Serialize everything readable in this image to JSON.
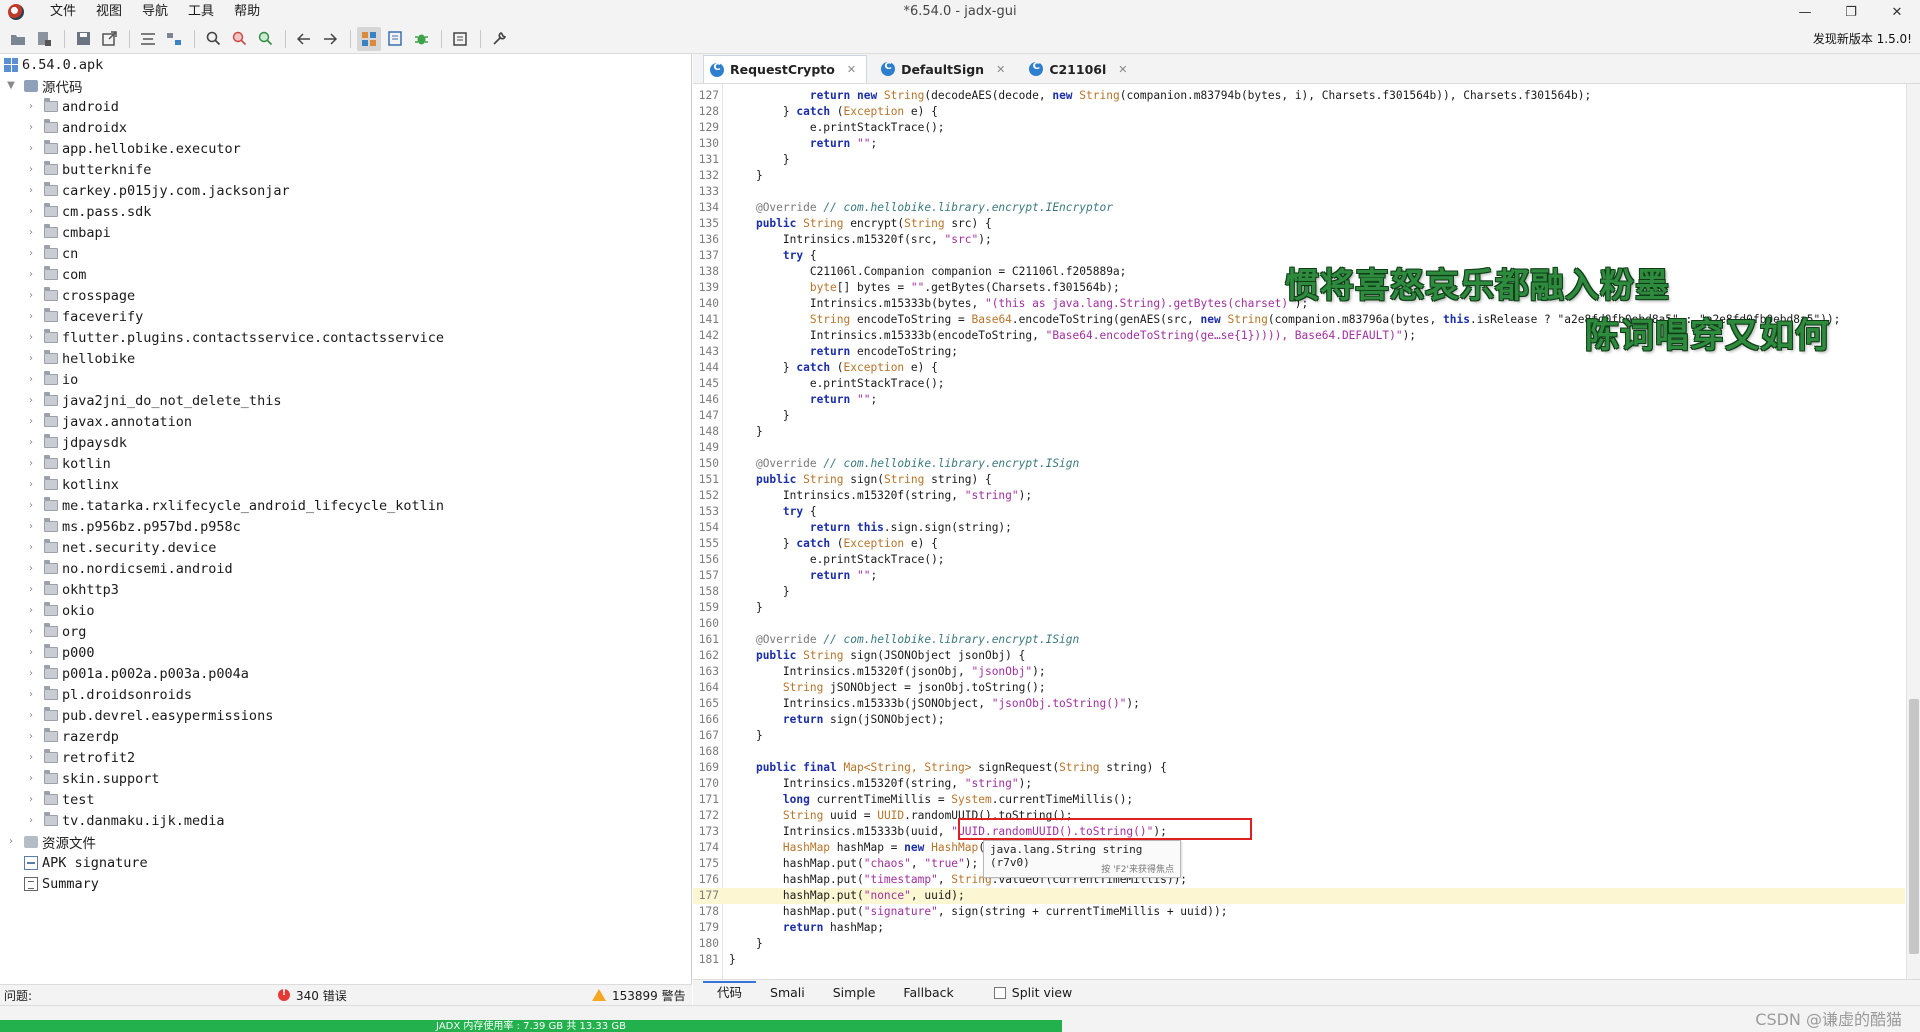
{
  "window": {
    "title": "*6.54.0 - jadx-gui",
    "menu": [
      "文件",
      "视图",
      "导航",
      "工具",
      "帮助"
    ],
    "controls": [
      "—",
      "❐",
      "✕"
    ]
  },
  "toolbar": {
    "update_note": "发现新版本 1.5.0!",
    "icons": [
      "open-file-icon",
      "add-files-icon",
      "save-icon",
      "export-icon",
      "sync-icon",
      "flatten-icon",
      "search-icon",
      "search-text-icon",
      "find-usage-icon",
      "back-icon",
      "forward-icon",
      "decompile-all-icon",
      "bookmark-icon",
      "debug-icon",
      "log-icon",
      "preferences-icon"
    ]
  },
  "tree": {
    "root": "6.54.0.apk",
    "source_node": "源代码",
    "packages": [
      "android",
      "androidx",
      "app.hellobike.executor",
      "butterknife",
      "carkey.p015jy.com.jacksonjar",
      "cm.pass.sdk",
      "cmbapi",
      "cn",
      "com",
      "crosspage",
      "faceverify",
      "flutter.plugins.contactsservice.contactsservice",
      "hellobike",
      "io",
      "java2jni_do_not_delete_this",
      "javax.annotation",
      "jdpaysdk",
      "kotlin",
      "kotlinx",
      "me.tatarka.rxlifecycle_android_lifecycle_kotlin",
      "ms.p956bz.p957bd.p958c",
      "net.security.device",
      "no.nordicsemi.android",
      "okhttp3",
      "okio",
      "org",
      "p000",
      "p001a.p002a.p003a.p004a",
      "pl.droidsonroids",
      "pub.devrel.easypermissions",
      "razerdp",
      "retrofit2",
      "skin.support",
      "test",
      "tv.danmaku.ijk.media"
    ],
    "resources_node": "资源文件",
    "signature_node": "APK signature",
    "summary_node": "Summary"
  },
  "tabs": [
    {
      "label": "RequestCrypto",
      "close": "✕"
    },
    {
      "label": "DefaultSign",
      "close": "✕"
    },
    {
      "label": "C21106l",
      "close": "✕"
    }
  ],
  "code": {
    "highlight_line": 177,
    "lines": [
      {
        "n": "127",
        "t": [
          [
            "",
            "            "
          ],
          [
            "kw",
            "return new "
          ],
          [
            "ty",
            "String"
          ],
          [
            "pl",
            "(decodeAES(decode, "
          ],
          [
            "kw",
            "new "
          ],
          [
            "ty",
            "String"
          ],
          [
            "pl",
            "(companion.m83794b(bytes, i), Charsets.f301564b)), Charsets.f301564b);"
          ]
        ]
      },
      {
        "n": "128",
        "t": [
          [
            "",
            "        "
          ],
          [
            "pl",
            "} "
          ],
          [
            "kw",
            "catch "
          ],
          [
            "pl",
            "("
          ],
          [
            "ty",
            "Exception"
          ],
          [
            "pl",
            " e) {"
          ]
        ]
      },
      {
        "n": "129",
        "t": [
          [
            "",
            "            "
          ],
          [
            "pl",
            "e.printStackTrace();"
          ]
        ]
      },
      {
        "n": "130",
        "t": [
          [
            "",
            "            "
          ],
          [
            "kw",
            "return "
          ],
          [
            "st",
            "\"\""
          ],
          [
            "pl",
            ";"
          ]
        ]
      },
      {
        "n": "131",
        "t": [
          [
            "",
            "        "
          ],
          [
            "pl",
            "}"
          ]
        ]
      },
      {
        "n": "132",
        "t": [
          [
            "",
            "    "
          ],
          [
            "pl",
            "}"
          ]
        ]
      },
      {
        "n": "133",
        "t": [
          [
            "",
            ""
          ]
        ]
      },
      {
        "n": "134",
        "t": [
          [
            "",
            "    "
          ],
          [
            "an",
            "@Override "
          ],
          [
            "cm",
            "// com.hellobike.library.encrypt.IEncryptor"
          ]
        ]
      },
      {
        "n": "135",
        "t": [
          [
            "",
            "    "
          ],
          [
            "kw",
            "public "
          ],
          [
            "ty",
            "String "
          ],
          [
            "pl",
            "encrypt("
          ],
          [
            "ty",
            "String "
          ],
          [
            "pl",
            "src) {"
          ]
        ]
      },
      {
        "n": "136",
        "t": [
          [
            "",
            "        "
          ],
          [
            "pl",
            "Intrinsics.m15320f(src, "
          ],
          [
            "st",
            "\"src\""
          ],
          [
            "pl",
            ");"
          ]
        ]
      },
      {
        "n": "137",
        "t": [
          [
            "",
            "        "
          ],
          [
            "kw",
            "try "
          ],
          [
            "pl",
            "{"
          ]
        ]
      },
      {
        "n": "138",
        "t": [
          [
            "",
            "            "
          ],
          [
            "pl",
            "C21106l.Companion companion = C21106l.f205889a;"
          ]
        ]
      },
      {
        "n": "139",
        "t": [
          [
            "",
            "            "
          ],
          [
            "ty",
            "byte"
          ],
          [
            "pl",
            "[] bytes = "
          ],
          [
            "st",
            "\"\""
          ],
          [
            "pl",
            ".getBytes(Charsets.f301564b);"
          ]
        ]
      },
      {
        "n": "140",
        "t": [
          [
            "",
            "            "
          ],
          [
            "pl",
            "Intrinsics.m15333b(bytes, "
          ],
          [
            "st",
            "\"(this as java.lang.String).getBytes(charset)\""
          ],
          [
            "pl",
            ");"
          ]
        ]
      },
      {
        "n": "141",
        "t": [
          [
            "",
            "            "
          ],
          [
            "ty",
            "String "
          ],
          [
            "pl",
            "encodeToString = "
          ],
          [
            "ty",
            "Base64"
          ],
          [
            "pl",
            ".encodeToString(genAES(src, "
          ],
          [
            "kw",
            "new "
          ],
          [
            "ty",
            "String"
          ],
          [
            "pl",
            "(companion.m83796a(bytes, "
          ],
          [
            "kw",
            "this"
          ],
          [
            "pl",
            ".isRelease ? \"a2e8fd0fb0ebd8a5\" : \"a2e8fd0fb0ebd8a5\"));"
          ]
        ]
      },
      {
        "n": "142",
        "t": [
          [
            "",
            "            "
          ],
          [
            "pl",
            "Intrinsics.m15333b(encodeToString, "
          ],
          [
            "st",
            "\"Base64.encodeToString(ge…se{1})))), Base64.DEFAULT)\""
          ],
          [
            "pl",
            ");"
          ]
        ]
      },
      {
        "n": "143",
        "t": [
          [
            "",
            "            "
          ],
          [
            "kw",
            "return "
          ],
          [
            "pl",
            "encodeToString;"
          ]
        ]
      },
      {
        "n": "144",
        "t": [
          [
            "",
            "        "
          ],
          [
            "pl",
            "} "
          ],
          [
            "kw",
            "catch "
          ],
          [
            "pl",
            "("
          ],
          [
            "ty",
            "Exception"
          ],
          [
            "pl",
            " e) {"
          ]
        ]
      },
      {
        "n": "145",
        "t": [
          [
            "",
            "            "
          ],
          [
            "pl",
            "e.printStackTrace();"
          ]
        ]
      },
      {
        "n": "146",
        "t": [
          [
            "",
            "            "
          ],
          [
            "kw",
            "return "
          ],
          [
            "st",
            "\"\""
          ],
          [
            "pl",
            ";"
          ]
        ]
      },
      {
        "n": "147",
        "t": [
          [
            "",
            "        "
          ],
          [
            "pl",
            "}"
          ]
        ]
      },
      {
        "n": "148",
        "t": [
          [
            "",
            "    "
          ],
          [
            "pl",
            "}"
          ]
        ]
      },
      {
        "n": "149",
        "t": [
          [
            "",
            ""
          ]
        ]
      },
      {
        "n": "150",
        "t": [
          [
            "",
            "    "
          ],
          [
            "an",
            "@Override "
          ],
          [
            "cm",
            "// com.hellobike.library.encrypt.ISign"
          ]
        ]
      },
      {
        "n": "151",
        "t": [
          [
            "",
            "    "
          ],
          [
            "kw",
            "public "
          ],
          [
            "ty",
            "String "
          ],
          [
            "pl",
            "sign("
          ],
          [
            "ty",
            "String "
          ],
          [
            "pl",
            "string) {"
          ]
        ]
      },
      {
        "n": "152",
        "t": [
          [
            "",
            "        "
          ],
          [
            "pl",
            "Intrinsics.m15320f(string, "
          ],
          [
            "st",
            "\"string\""
          ],
          [
            "pl",
            ");"
          ]
        ]
      },
      {
        "n": "153",
        "t": [
          [
            "",
            "        "
          ],
          [
            "kw",
            "try "
          ],
          [
            "pl",
            "{"
          ]
        ]
      },
      {
        "n": "154",
        "t": [
          [
            "",
            "            "
          ],
          [
            "kw",
            "return this"
          ],
          [
            "pl",
            ".sign.sign(string);"
          ]
        ]
      },
      {
        "n": "155",
        "t": [
          [
            "",
            "        "
          ],
          [
            "pl",
            "} "
          ],
          [
            "kw",
            "catch "
          ],
          [
            "pl",
            "("
          ],
          [
            "ty",
            "Exception"
          ],
          [
            "pl",
            " e) {"
          ]
        ]
      },
      {
        "n": "156",
        "t": [
          [
            "",
            "            "
          ],
          [
            "pl",
            "e.printStackTrace();"
          ]
        ]
      },
      {
        "n": "157",
        "t": [
          [
            "",
            "            "
          ],
          [
            "kw",
            "return "
          ],
          [
            "st",
            "\"\""
          ],
          [
            "pl",
            ";"
          ]
        ]
      },
      {
        "n": "158",
        "t": [
          [
            "",
            "        "
          ],
          [
            "pl",
            "}"
          ]
        ]
      },
      {
        "n": "159",
        "t": [
          [
            "",
            "    "
          ],
          [
            "pl",
            "}"
          ]
        ]
      },
      {
        "n": "160",
        "t": [
          [
            "",
            ""
          ]
        ]
      },
      {
        "n": "161",
        "t": [
          [
            "",
            "    "
          ],
          [
            "an",
            "@Override "
          ],
          [
            "cm",
            "// com.hellobike.library.encrypt.ISign"
          ]
        ]
      },
      {
        "n": "162",
        "t": [
          [
            "",
            "    "
          ],
          [
            "kw",
            "public "
          ],
          [
            "ty",
            "String "
          ],
          [
            "pl",
            "sign(JSONObject jsonObj) {"
          ]
        ]
      },
      {
        "n": "163",
        "t": [
          [
            "",
            "        "
          ],
          [
            "pl",
            "Intrinsics.m15320f(jsonObj, "
          ],
          [
            "st",
            "\"jsonObj\""
          ],
          [
            "pl",
            ");"
          ]
        ]
      },
      {
        "n": "164",
        "t": [
          [
            "",
            "        "
          ],
          [
            "ty",
            "String "
          ],
          [
            "pl",
            "jSONObject = jsonObj.toString();"
          ]
        ]
      },
      {
        "n": "165",
        "t": [
          [
            "",
            "        "
          ],
          [
            "pl",
            "Intrinsics.m15333b(jSONObject, "
          ],
          [
            "st",
            "\"jsonObj.toString()\""
          ],
          [
            "pl",
            ");"
          ]
        ]
      },
      {
        "n": "166",
        "t": [
          [
            "",
            "        "
          ],
          [
            "kw",
            "return "
          ],
          [
            "pl",
            "sign(jSONObject);"
          ]
        ]
      },
      {
        "n": "167",
        "t": [
          [
            "",
            "    "
          ],
          [
            "pl",
            "}"
          ]
        ]
      },
      {
        "n": "168",
        "t": [
          [
            "",
            ""
          ]
        ]
      },
      {
        "n": "169",
        "t": [
          [
            "",
            "    "
          ],
          [
            "kw",
            "public final "
          ],
          [
            "ty",
            "Map<String, String> "
          ],
          [
            "pl",
            "signRequest("
          ],
          [
            "ty",
            "String "
          ],
          [
            "pl",
            "string) {"
          ]
        ]
      },
      {
        "n": "170",
        "t": [
          [
            "",
            "        "
          ],
          [
            "pl",
            "Intrinsics.m15320f(string, "
          ],
          [
            "st",
            "\"string\""
          ],
          [
            "pl",
            ");"
          ]
        ]
      },
      {
        "n": "171",
        "t": [
          [
            "",
            "        "
          ],
          [
            "kw",
            "long "
          ],
          [
            "pl",
            "currentTimeMillis = "
          ],
          [
            "ty",
            "System"
          ],
          [
            "pl",
            ".currentTimeMillis();"
          ]
        ]
      },
      {
        "n": "172",
        "t": [
          [
            "",
            "        "
          ],
          [
            "ty",
            "String "
          ],
          [
            "pl",
            "uuid = "
          ],
          [
            "ty",
            "UUID"
          ],
          [
            "pl",
            ".randomUUID().toString();"
          ]
        ]
      },
      {
        "n": "173",
        "t": [
          [
            "",
            "        "
          ],
          [
            "pl",
            "Intrinsics.m15333b(uuid, "
          ],
          [
            "st",
            "\"UUID.randomUUID().toString()\""
          ],
          [
            "pl",
            ");"
          ]
        ]
      },
      {
        "n": "174",
        "t": [
          [
            "",
            "        "
          ],
          [
            "ty",
            "HashMap "
          ],
          [
            "pl",
            "hashMap = "
          ],
          [
            "kw",
            "new "
          ],
          [
            "ty",
            "HashMap"
          ],
          [
            "pl",
            "();"
          ]
        ]
      },
      {
        "n": "175",
        "t": [
          [
            "",
            "        "
          ],
          [
            "pl",
            "hashMap.put("
          ],
          [
            "st",
            "\"chaos\""
          ],
          [
            "pl",
            ", "
          ],
          [
            "st",
            "\"true\""
          ],
          [
            "pl",
            ");"
          ]
        ]
      },
      {
        "n": "176",
        "t": [
          [
            "",
            "        "
          ],
          [
            "pl",
            "hashMap.put("
          ],
          [
            "st",
            "\"timestamp\""
          ],
          [
            "pl",
            ", "
          ],
          [
            "ty",
            "String"
          ],
          [
            "pl",
            ".valueOf(currentTimeMillis));"
          ]
        ]
      },
      {
        "n": "177",
        "t": [
          [
            "",
            "        "
          ],
          [
            "pl",
            "hashMap.put("
          ],
          [
            "st",
            "\"nonce\""
          ],
          [
            "pl",
            ", uuid);"
          ]
        ]
      },
      {
        "n": "178",
        "t": [
          [
            "",
            "        "
          ],
          [
            "pl",
            "hashMap.put("
          ],
          [
            "st",
            "\"signature\""
          ],
          [
            "pl",
            ", sign(string + currentTimeMillis + uuid));"
          ]
        ]
      },
      {
        "n": "179",
        "t": [
          [
            "",
            "        "
          ],
          [
            "kw",
            "return "
          ],
          [
            "pl",
            "hashMap;"
          ]
        ]
      },
      {
        "n": "180",
        "t": [
          [
            "",
            "    "
          ],
          [
            "pl",
            "}"
          ]
        ]
      },
      {
        "n": "181",
        "t": [
          [
            "",
            ""
          ],
          [
            "pl",
            "}"
          ]
        ]
      }
    ]
  },
  "tooltip": {
    "main": "java.lang.String string (r7v0)",
    "hint": "按 'F2'来获得焦点"
  },
  "poem": {
    "line1": "惯将喜怒哀乐都融入粉墨",
    "line2": "陈词唱穿又如何"
  },
  "view_tabs": [
    "代码",
    "Smali",
    "Simple",
    "Fallback"
  ],
  "split_view_label": "Split view",
  "problems": {
    "label": "问题:",
    "errors": "340 错误",
    "warnings": "153899 警告"
  },
  "status": {
    "memory": "JADX 内存使用率 : 7.39 GB 共 13.33 GB",
    "credit": "CSDN @谦虚的酷猫"
  },
  "colors": {
    "keyword": "#1b2ea8",
    "type": "#b8742a",
    "string": "#a22fa1",
    "comment": "#3b7a80",
    "memory_bar": "#22b14c",
    "highlight_line": "#fdf6d2",
    "red_box": "#e02020",
    "poem": "#2e8b3e"
  }
}
